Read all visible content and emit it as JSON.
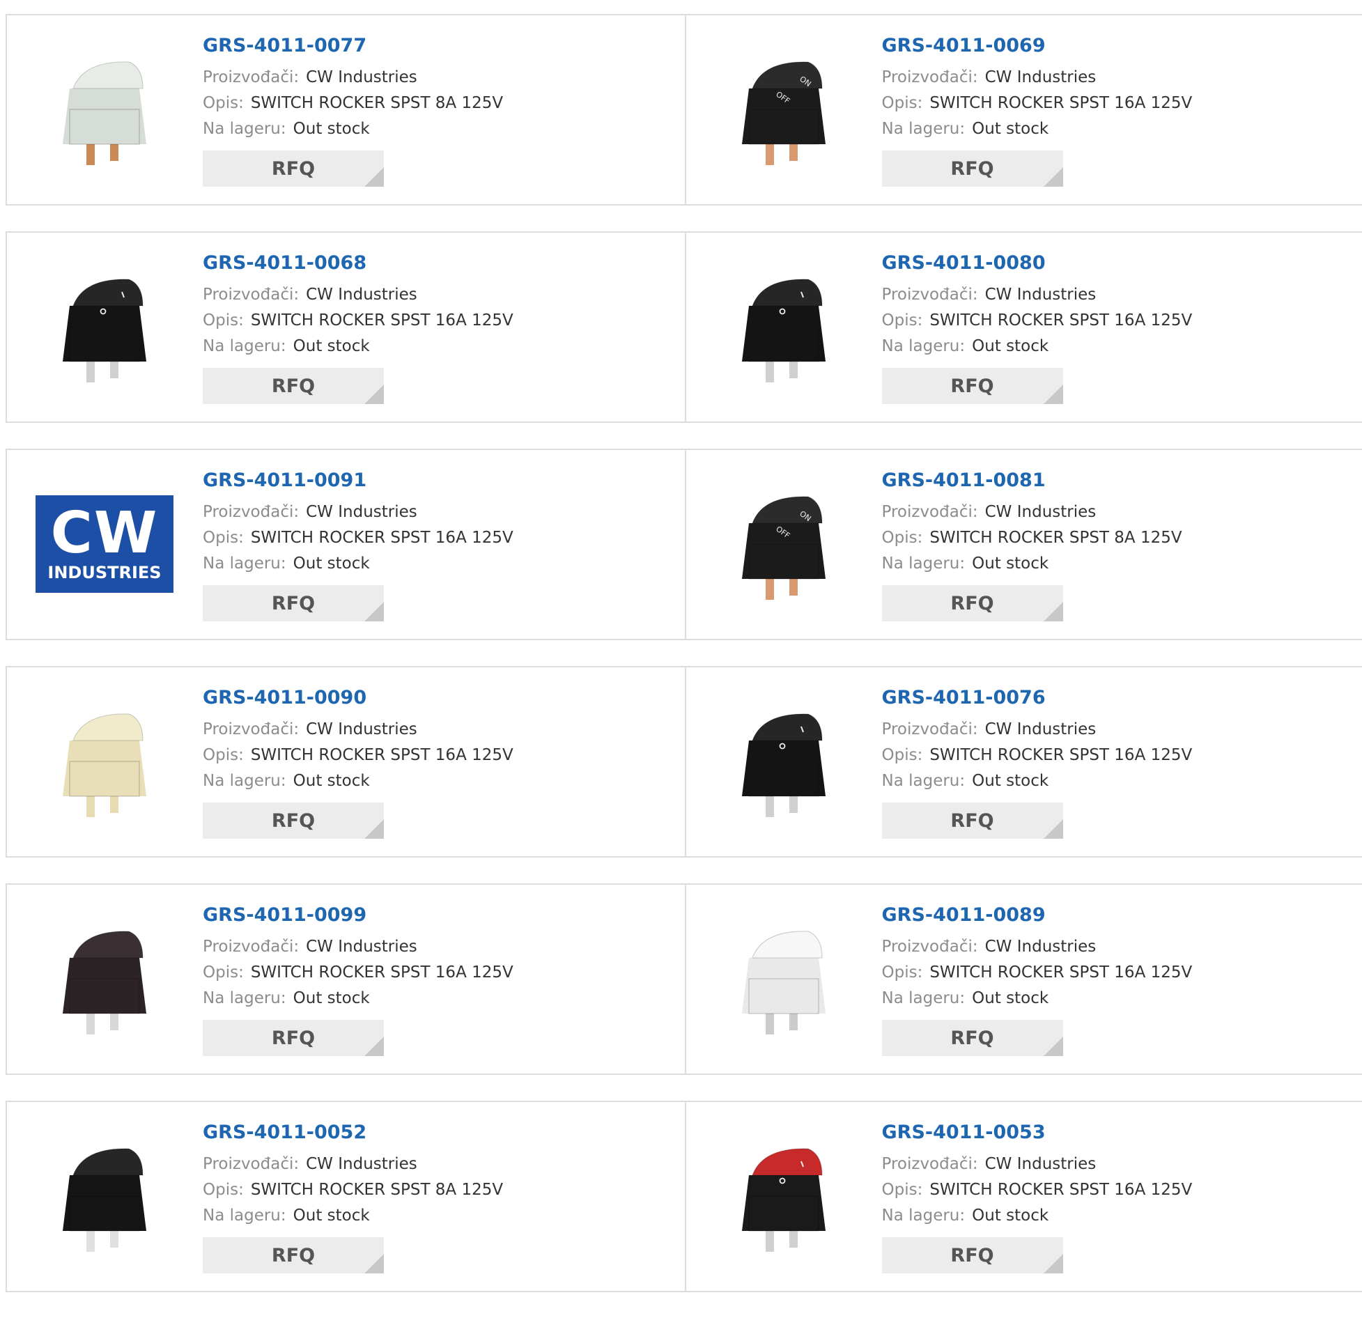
{
  "labels": {
    "manufacturer": "Proizvođači:",
    "description": "Opis:",
    "stock": "Na lageru:",
    "rfq": "RFQ"
  },
  "colors": {
    "part_link": "#1f66b0",
    "label": "#8c8c8c",
    "border": "#dcdcdc",
    "button_bg": "#ececec",
    "logo_blue": "#1d4fa6"
  },
  "products": [
    {
      "part": "GRS-4011-0077",
      "manufacturer": "CW Industries",
      "description": "SWITCH ROCKER SPST 8A 125V",
      "stock": "Out stock",
      "image": "rocker-switch-light-gray"
    },
    {
      "part": "GRS-4011-0069",
      "manufacturer": "CW Industries",
      "description": "SWITCH ROCKER SPST 16A 125V",
      "stock": "Out stock",
      "image": "rocker-switch-black-on-off"
    },
    {
      "part": "GRS-4011-0068",
      "manufacturer": "CW Industries",
      "description": "SWITCH ROCKER SPST 16A 125V",
      "stock": "Out stock",
      "image": "rocker-switch-black-i-o"
    },
    {
      "part": "GRS-4011-0080",
      "manufacturer": "CW Industries",
      "description": "SWITCH ROCKER SPST 16A 125V",
      "stock": "Out stock",
      "image": "rocker-switch-black-i-o"
    },
    {
      "part": "GRS-4011-0091",
      "manufacturer": "CW Industries",
      "description": "SWITCH ROCKER SPST 16A 125V",
      "stock": "Out stock",
      "image": "cw-industries-logo",
      "logo_text_big": "CW",
      "logo_text_small": "INDUSTRIES"
    },
    {
      "part": "GRS-4011-0081",
      "manufacturer": "CW Industries",
      "description": "SWITCH ROCKER SPST 8A 125V",
      "stock": "Out stock",
      "image": "rocker-switch-black-on-off"
    },
    {
      "part": "GRS-4011-0090",
      "manufacturer": "CW Industries",
      "description": "SWITCH ROCKER SPST 16A 125V",
      "stock": "Out stock",
      "image": "rocker-switch-ivory"
    },
    {
      "part": "GRS-4011-0076",
      "manufacturer": "CW Industries",
      "description": "SWITCH ROCKER SPST 16A 125V",
      "stock": "Out stock",
      "image": "rocker-switch-black-i-o"
    },
    {
      "part": "GRS-4011-0099",
      "manufacturer": "CW Industries",
      "description": "SWITCH ROCKER SPST 16A 125V",
      "stock": "Out stock",
      "image": "rocker-switch-dark-brown"
    },
    {
      "part": "GRS-4011-0089",
      "manufacturer": "CW Industries",
      "description": "SWITCH ROCKER SPST 16A 125V",
      "stock": "Out stock",
      "image": "rocker-switch-white"
    },
    {
      "part": "GRS-4011-0052",
      "manufacturer": "CW Industries",
      "description": "SWITCH ROCKER SPST 8A 125V",
      "stock": "Out stock",
      "image": "rocker-switch-black"
    },
    {
      "part": "GRS-4011-0053",
      "manufacturer": "CW Industries",
      "description": "SWITCH ROCKER SPST 16A 125V",
      "stock": "Out stock",
      "image": "rocker-switch-red-i-o"
    }
  ]
}
